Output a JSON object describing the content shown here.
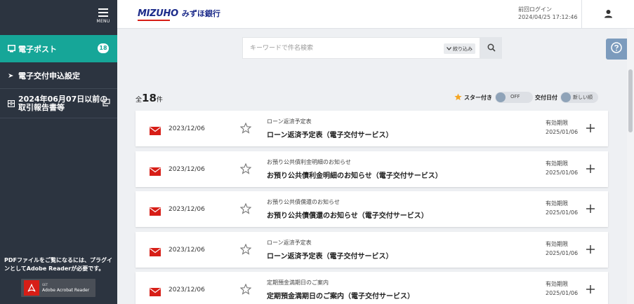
{
  "sidebar": {
    "menu_label": "MENU",
    "items": [
      {
        "label": "電子ポスト",
        "badge": "18"
      },
      {
        "label": "電子交付申込設定"
      },
      {
        "label_line1": "2024年06月07日以前の",
        "label_line2": "取引報告書等"
      }
    ],
    "pdf_note": "PDFファイルをご覧になるには、プラグインとしてAdobe Readerが必要です。",
    "adobe": {
      "get": "GET",
      "label": "Adobe Acrobat Reader"
    }
  },
  "header": {
    "brand_en": "MIZUHO",
    "brand_ja": "みずほ銀行",
    "last_login_label": "前回ログイン",
    "last_login_time": "2024/04/25 17:12:46"
  },
  "search": {
    "placeholder": "キーワードで件名検索",
    "filter_label": "絞り込み"
  },
  "count": {
    "prefix": "全",
    "value": "18",
    "suffix": "件"
  },
  "controls": {
    "star_label": "スター付き",
    "star_toggle": "OFF",
    "date_label": "交付日付",
    "date_toggle": "新しい順"
  },
  "items": [
    {
      "date": "2023/12/06",
      "category": "ローン返済予定表",
      "title": "ローン返済予定表（電子交付サービス）",
      "exp_label": "有効期限",
      "exp_date": "2025/01/06"
    },
    {
      "date": "2023/12/06",
      "category": "お預り公共債利金明細のお知らせ",
      "title": "お預り公共債利金明細のお知らせ（電子交付サービス）",
      "exp_label": "有効期限",
      "exp_date": "2025/01/06"
    },
    {
      "date": "2023/12/06",
      "category": "お預り公共債償還のお知らせ",
      "title": "お預り公共債償還のお知らせ（電子交付サービス）",
      "exp_label": "有効期限",
      "exp_date": "2025/01/06"
    },
    {
      "date": "2023/12/06",
      "category": "ローン返済予定表",
      "title": "ローン返済予定表（電子交付サービス）",
      "exp_label": "有効期限",
      "exp_date": "2025/01/06"
    },
    {
      "date": "2023/12/06",
      "category": "定期預金満期日のご案内",
      "title": "定期預金満期日のご案内（電子交付サービス）",
      "exp_label": "有効期限",
      "exp_date": "2025/01/06"
    }
  ],
  "colors": {
    "accent": "#16a698",
    "sidebar": "#2c3440",
    "mail": "#d71e17",
    "star": "#f5a623",
    "brand": "#1c2b8a"
  }
}
